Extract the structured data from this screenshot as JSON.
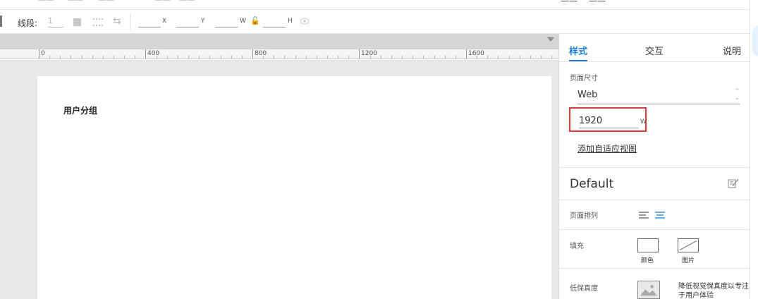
{
  "toolbar": {
    "line_label": "线段:",
    "line_value": "1",
    "x_label": "X",
    "y_label": "Y",
    "w_label": "W",
    "h_label": "H"
  },
  "ruler": {
    "labels": [
      "0",
      "400",
      "800",
      "1200",
      "1600"
    ]
  },
  "canvas": {
    "page_title": "用户分组"
  },
  "panel": {
    "tabs": [
      {
        "label": "样式",
        "active": true
      },
      {
        "label": "交互",
        "active": false
      },
      {
        "label": "说明",
        "active": false
      }
    ],
    "page_size_label": "页面尺寸",
    "page_size_value": "Web",
    "width_value": "1920",
    "width_unit": "W",
    "add_adaptive_view": "添加自适应视图",
    "style_name": "Default",
    "page_align_label": "页面排列",
    "fill_label": "填充",
    "fill_color_caption": "颜色",
    "fill_image_caption": "图片",
    "low_fidelity_label": "低保真度",
    "low_fidelity_desc": "降低视觉保真度以专注于用户体验"
  },
  "colors": {
    "accent": "#1a7fd4",
    "highlight_border": "#e03a3a"
  }
}
